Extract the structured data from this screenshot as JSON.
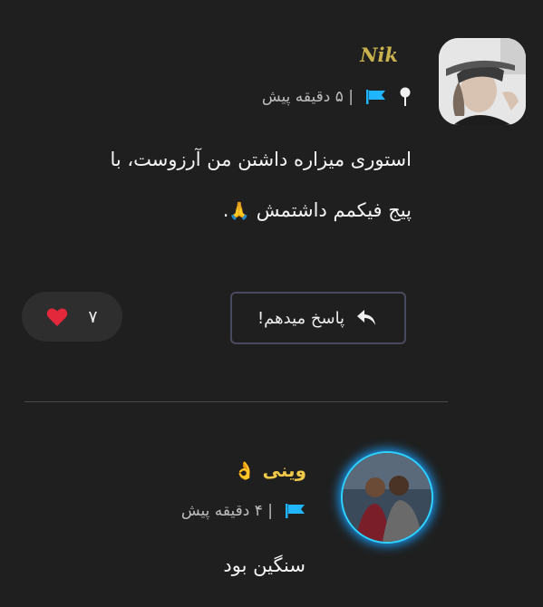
{
  "comments": [
    {
      "author": "Nik",
      "time": "۵ دقیقه پیش",
      "time_prefix": "|",
      "text_line1": "استوری میزاره داشتن من آرزوست، با",
      "text_line2": "پیج فیکمم داشتمش",
      "text_end": ".",
      "emoji": "🙏",
      "reply_label": "پاسخ میدهم!",
      "likes": "۷",
      "icons": [
        "pin-icon",
        "flag-icon",
        "reply-arrow-icon",
        "heart-icon"
      ]
    },
    {
      "author": "وینی",
      "author_emoji": "👌",
      "time": "۴ دقیقه پیش",
      "time_prefix": "|",
      "text": "سنگین بود",
      "icons": [
        "flag-icon"
      ]
    }
  ],
  "colors": {
    "background": "#1f1f1f",
    "author1": "#c9b24e",
    "author2": "#f0c948",
    "flag": "#1fb6ff",
    "heart": "#e3283b",
    "avatar_ring": "#2ed3ff"
  }
}
